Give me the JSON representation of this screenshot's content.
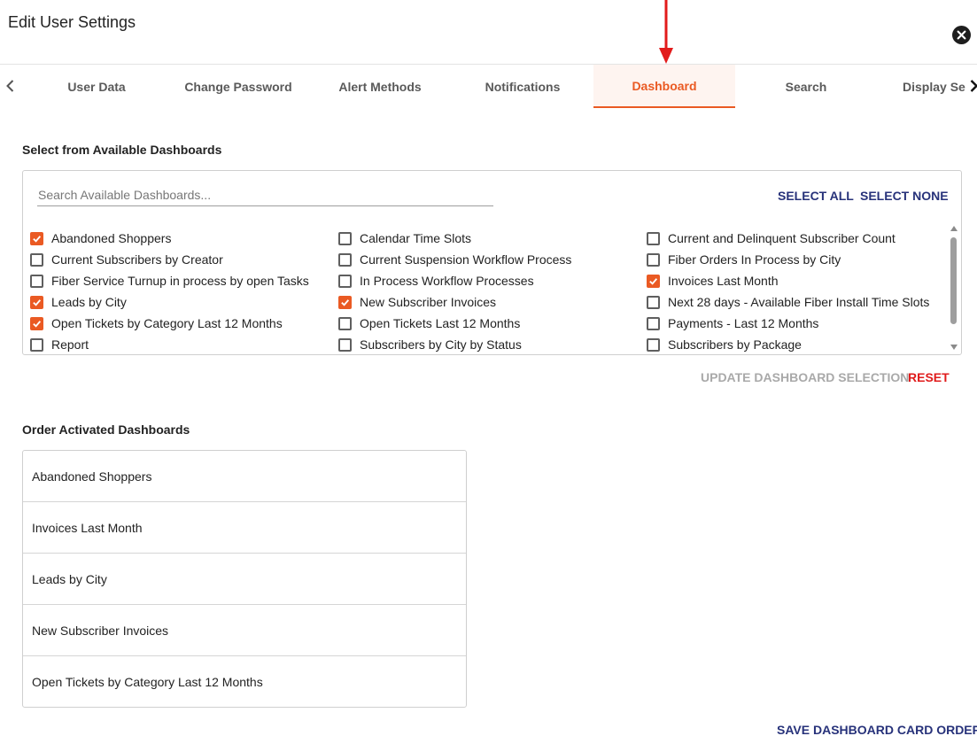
{
  "dialog": {
    "title": "Edit User Settings"
  },
  "tabs": [
    {
      "label": "User Data",
      "active": false
    },
    {
      "label": "Change Password",
      "active": false
    },
    {
      "label": "Alert Methods",
      "active": false
    },
    {
      "label": "Notifications",
      "active": false
    },
    {
      "label": "Dashboard",
      "active": true
    },
    {
      "label": "Search",
      "active": false
    },
    {
      "label": "Display Se",
      "active": false
    }
  ],
  "available": {
    "heading": "Select from Available Dashboards",
    "search_placeholder": "Search Available Dashboards...",
    "select_all": "SELECT ALL",
    "select_none": "SELECT NONE",
    "columns": [
      [
        {
          "label": "Abandoned Shoppers",
          "checked": true
        },
        {
          "label": "Current Subscribers by Creator",
          "checked": false
        },
        {
          "label": "Fiber Service Turnup in process by open Tasks",
          "checked": false
        },
        {
          "label": "Leads by City",
          "checked": true
        },
        {
          "label": "Open Tickets by Category Last 12 Months",
          "checked": true
        },
        {
          "label": "Report",
          "checked": false
        }
      ],
      [
        {
          "label": "Calendar Time Slots",
          "checked": false
        },
        {
          "label": "Current Suspension Workflow Process",
          "checked": false
        },
        {
          "label": "In Process Workflow Processes",
          "checked": false
        },
        {
          "label": "New Subscriber Invoices",
          "checked": true
        },
        {
          "label": "Open Tickets Last 12 Months",
          "checked": false
        },
        {
          "label": "Subscribers by City by Status",
          "checked": false
        }
      ],
      [
        {
          "label": "Current and Delinquent Subscriber Count",
          "checked": false
        },
        {
          "label": "Fiber Orders In Process by City",
          "checked": false
        },
        {
          "label": "Invoices Last Month",
          "checked": true
        },
        {
          "label": "Next 28 days - Available Fiber Install Time Slots",
          "checked": false
        },
        {
          "label": "Payments - Last 12 Months",
          "checked": false
        },
        {
          "label": "Subscribers by Package",
          "checked": false
        }
      ]
    ],
    "update_button": "UPDATE DASHBOARD SELECTION",
    "reset_button": "RESET"
  },
  "activated": {
    "heading": "Order Activated Dashboards",
    "items": [
      "Abandoned Shoppers",
      "Invoices Last Month",
      "Leads by City",
      "New Subscriber Invoices",
      "Open Tickets by Category Last 12 Months"
    ],
    "save_button": "SAVE DASHBOARD CARD ORDER"
  },
  "colors": {
    "accent": "#ea5a23",
    "link": "#27327a",
    "reset": "#e01b1b",
    "disabled": "#a9a9a9",
    "annotation_arrow": "#e21b1b"
  }
}
